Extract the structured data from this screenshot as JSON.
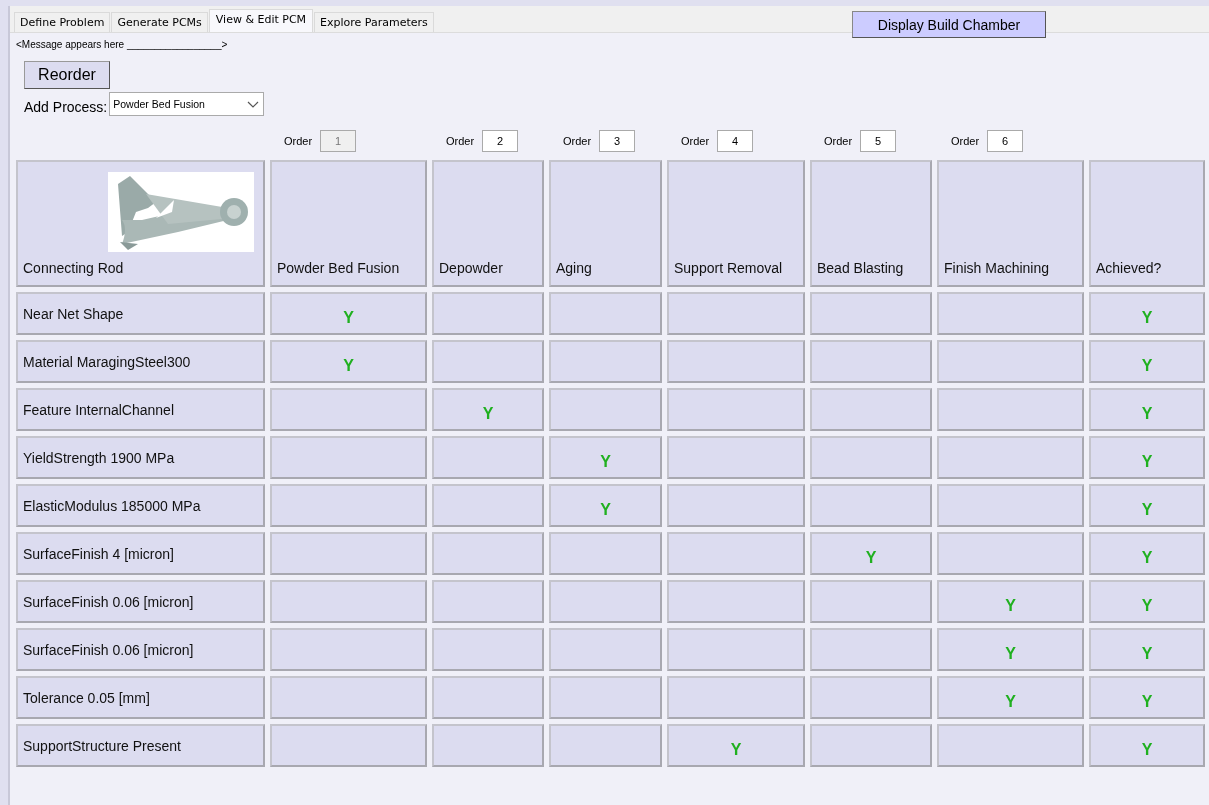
{
  "tabs": [
    {
      "label": "Define Problem",
      "selected": false
    },
    {
      "label": "Generate PCMs",
      "selected": false
    },
    {
      "label": "View & Edit PCM",
      "selected": true
    },
    {
      "label": "Explore Parameters",
      "selected": false
    }
  ],
  "build_chamber_button": "Display Build Chamber",
  "message": "<Message appears here _________________>",
  "reorder_button": "Reorder",
  "add_process": {
    "label": "Add Process:",
    "value": "Powder Bed Fusion"
  },
  "part": {
    "name": "Connecting Rod"
  },
  "processes": [
    {
      "name": "Powder Bed Fusion",
      "order_label": "Order",
      "order": "1",
      "disabled": true
    },
    {
      "name": "Depowder",
      "order_label": "Order",
      "order": "2",
      "disabled": false
    },
    {
      "name": "Aging",
      "order_label": "Order",
      "order": "3",
      "disabled": false
    },
    {
      "name": "Support Removal",
      "order_label": "Order",
      "order": "4",
      "disabled": false
    },
    {
      "name": "Bead Blasting",
      "order_label": "Order",
      "order": "5",
      "disabled": false
    },
    {
      "name": "Finish Machining",
      "order_label": "Order",
      "order": "6",
      "disabled": false
    }
  ],
  "achieved_heading": "Achieved?",
  "rows": [
    {
      "label": "Near Net Shape",
      "cells": [
        "Y",
        null,
        null,
        null,
        null,
        null
      ],
      "achieved": "Y"
    },
    {
      "label": "Material MaragingSteel300",
      "cells": [
        "Y",
        null,
        null,
        null,
        null,
        null
      ],
      "achieved": "Y"
    },
    {
      "label": "Feature InternalChannel",
      "cells": [
        null,
        "Y",
        null,
        null,
        null,
        null
      ],
      "achieved": "Y"
    },
    {
      "label": "YieldStrength 1900 MPa",
      "cells": [
        null,
        null,
        "Y",
        null,
        null,
        null
      ],
      "achieved": "Y"
    },
    {
      "label": "ElasticModulus 185000 MPa",
      "cells": [
        null,
        null,
        "Y",
        null,
        null,
        null
      ],
      "achieved": "Y"
    },
    {
      "label": "SurfaceFinish 4 [micron]",
      "cells": [
        null,
        null,
        null,
        null,
        "Y",
        null
      ],
      "achieved": "Y"
    },
    {
      "label": "SurfaceFinish 0.06 [micron]",
      "cells": [
        null,
        null,
        null,
        null,
        null,
        "Y"
      ],
      "achieved": "Y"
    },
    {
      "label": "SurfaceFinish 0.06 [micron]",
      "cells": [
        null,
        null,
        null,
        null,
        null,
        "Y"
      ],
      "achieved": "Y"
    },
    {
      "label": "Tolerance 0.05 [mm]",
      "cells": [
        null,
        null,
        null,
        null,
        null,
        "Y"
      ],
      "achieved": "Y"
    },
    {
      "label": "SupportStructure Present",
      "cells": [
        null,
        null,
        null,
        "Y",
        null,
        null
      ],
      "achieved": "Y"
    }
  ]
}
